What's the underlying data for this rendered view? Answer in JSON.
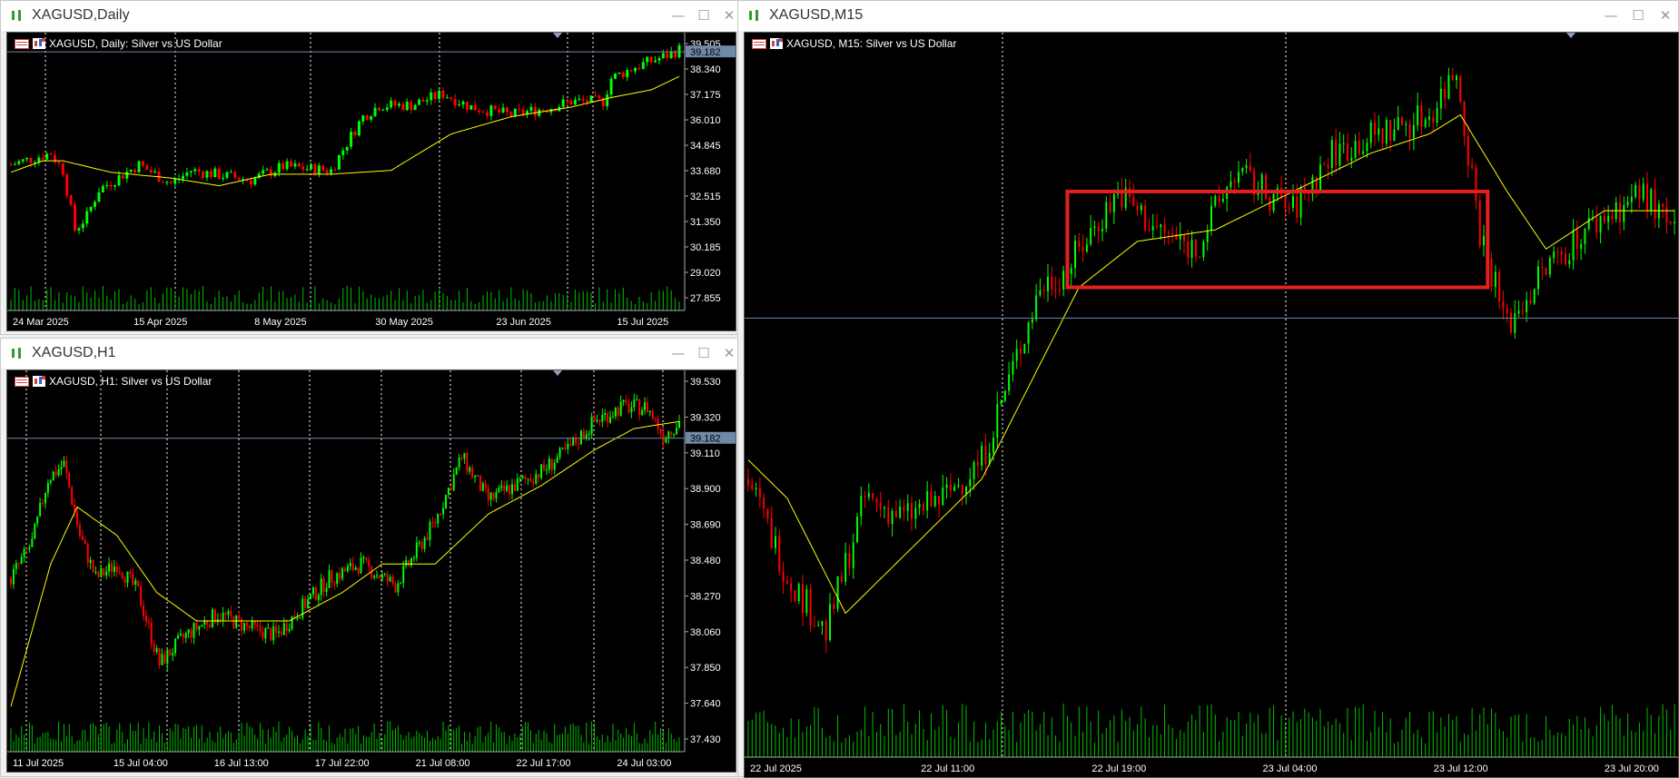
{
  "colors": {
    "bull": "#00ff00",
    "bear": "#ff0000",
    "ma": "#ffff00",
    "volume": "#00c000",
    "price_line": "#6f8aa8",
    "grid": "#ffffff",
    "axis_text": "#ffffff",
    "box": "#e32020"
  },
  "windows": [
    {
      "id": "daily",
      "title": "XAGUSD,Daily",
      "symbol_label": "XAGUSD, Daily:  Silver vs US Dollar",
      "current_price": "39.182",
      "price_axis": [
        "39.505",
        "38.340",
        "37.175",
        "36.010",
        "34.845",
        "33.680",
        "32.515",
        "31.350",
        "30.185",
        "29.020",
        "27.855"
      ],
      "time_axis": [
        "24 Mar 2025",
        "15 Apr 2025",
        "8 May 2025",
        "30 May 2025",
        "23 Jun 2025",
        "15 Jul 2025"
      ],
      "chart_data": {
        "type": "candlestick",
        "ylim": [
          27.3,
          39.9
        ],
        "anchors": [
          [
            0,
            33.3
          ],
          [
            10,
            33.9
          ],
          [
            13,
            33.0
          ],
          [
            16,
            29.9
          ],
          [
            19,
            30.6
          ],
          [
            22,
            32.0
          ],
          [
            32,
            33.3
          ],
          [
            40,
            32.3
          ],
          [
            45,
            33.0
          ],
          [
            60,
            32.5
          ],
          [
            68,
            33.2
          ],
          [
            80,
            33.0
          ],
          [
            85,
            34.8
          ],
          [
            88,
            35.8
          ],
          [
            92,
            36.4
          ],
          [
            100,
            36.4
          ],
          [
            108,
            37.0
          ],
          [
            115,
            36.3
          ],
          [
            125,
            35.9
          ],
          [
            135,
            36.3
          ],
          [
            140,
            36.6
          ],
          [
            148,
            36.6
          ],
          [
            150,
            37.8
          ],
          [
            156,
            38.4
          ],
          [
            164,
            39.0
          ],
          [
            167,
            39.3
          ]
        ],
        "n": 168,
        "ma_anchors": [
          [
            0,
            32.9
          ],
          [
            8,
            33.5
          ],
          [
            13,
            33.5
          ],
          [
            25,
            32.9
          ],
          [
            40,
            32.6
          ],
          [
            52,
            32.2
          ],
          [
            65,
            32.8
          ],
          [
            80,
            32.8
          ],
          [
            95,
            33.0
          ],
          [
            110,
            34.9
          ],
          [
            125,
            35.8
          ],
          [
            140,
            36.3
          ],
          [
            150,
            36.8
          ],
          [
            160,
            37.2
          ],
          [
            167,
            37.9
          ]
        ]
      }
    },
    {
      "id": "h1",
      "title": "XAGUSD,H1",
      "symbol_label": "XAGUSD, H1:  Silver vs US Dollar",
      "current_price": "39.182",
      "price_axis": [
        "39.530",
        "39.320",
        "39.110",
        "38.900",
        "38.690",
        "38.480",
        "38.270",
        "38.060",
        "37.850",
        "37.640",
        "37.430"
      ],
      "time_axis": [
        "11 Jul 2025",
        "15 Jul 04:00",
        "16 Jul 13:00",
        "17 Jul 22:00",
        "21 Jul 08:00",
        "22 Jul 17:00",
        "24 Jul 03:00"
      ],
      "chart_data": {
        "type": "candlestick",
        "ylim": [
          37.25,
          39.62
        ],
        "anchors": [
          [
            0,
            38.2
          ],
          [
            8,
            38.45
          ],
          [
            14,
            38.9
          ],
          [
            20,
            39.0
          ],
          [
            26,
            38.5
          ],
          [
            32,
            38.2
          ],
          [
            40,
            38.3
          ],
          [
            48,
            38.1
          ],
          [
            56,
            37.6
          ],
          [
            66,
            37.8
          ],
          [
            78,
            37.95
          ],
          [
            90,
            37.85
          ],
          [
            100,
            37.8
          ],
          [
            110,
            38.0
          ],
          [
            120,
            38.2
          ],
          [
            132,
            38.3
          ],
          [
            145,
            38.15
          ],
          [
            160,
            38.6
          ],
          [
            170,
            39.05
          ],
          [
            180,
            38.75
          ],
          [
            190,
            38.85
          ],
          [
            200,
            38.95
          ],
          [
            210,
            39.1
          ],
          [
            220,
            39.3
          ],
          [
            230,
            39.4
          ],
          [
            240,
            39.4
          ],
          [
            246,
            39.2
          ],
          [
            252,
            39.3
          ]
        ],
        "n": 253,
        "ma_anchors": [
          [
            0,
            37.3
          ],
          [
            15,
            38.3
          ],
          [
            25,
            38.7
          ],
          [
            40,
            38.5
          ],
          [
            55,
            38.1
          ],
          [
            70,
            37.9
          ],
          [
            90,
            37.9
          ],
          [
            105,
            37.9
          ],
          [
            125,
            38.1
          ],
          [
            140,
            38.3
          ],
          [
            160,
            38.3
          ],
          [
            180,
            38.65
          ],
          [
            200,
            38.85
          ],
          [
            220,
            39.1
          ],
          [
            235,
            39.25
          ],
          [
            252,
            39.3
          ]
        ]
      }
    },
    {
      "id": "m15",
      "title": "XAGUSD,M15",
      "symbol_label": "XAGUSD, M15:  Silver vs US Dollar",
      "time_axis": [
        "22 Jul 2025",
        "22 Jul 11:00",
        "22 Jul 19:00",
        "23 Jul 04:00",
        "23 Jul 12:00",
        "23 Jul 20:00"
      ],
      "chart_data": {
        "type": "candlestick",
        "ylim": [
          38.0,
          39.7
        ],
        "anchors": [
          [
            0,
            38.55
          ],
          [
            10,
            38.3
          ],
          [
            20,
            38.15
          ],
          [
            30,
            38.5
          ],
          [
            40,
            38.45
          ],
          [
            50,
            38.5
          ],
          [
            60,
            38.6
          ],
          [
            70,
            38.9
          ],
          [
            75,
            39.05
          ],
          [
            82,
            39.1
          ],
          [
            95,
            39.3
          ],
          [
            105,
            39.2
          ],
          [
            115,
            39.15
          ],
          [
            125,
            39.35
          ],
          [
            140,
            39.25
          ],
          [
            150,
            39.4
          ],
          [
            162,
            39.45
          ],
          [
            175,
            39.5
          ],
          [
            182,
            39.62
          ],
          [
            188,
            39.2
          ],
          [
            195,
            38.95
          ],
          [
            205,
            39.1
          ],
          [
            215,
            39.2
          ],
          [
            230,
            39.3
          ],
          [
            238,
            39.18
          ]
        ],
        "n": 239,
        "ma_anchors": [
          [
            0,
            38.6
          ],
          [
            10,
            38.5
          ],
          [
            25,
            38.2
          ],
          [
            40,
            38.35
          ],
          [
            60,
            38.55
          ],
          [
            70,
            38.75
          ],
          [
            85,
            39.05
          ],
          [
            100,
            39.17
          ],
          [
            120,
            39.2
          ],
          [
            140,
            39.3
          ],
          [
            160,
            39.4
          ],
          [
            175,
            39.45
          ],
          [
            183,
            39.5
          ],
          [
            195,
            39.3
          ],
          [
            205,
            39.15
          ],
          [
            220,
            39.25
          ],
          [
            238,
            39.25
          ]
        ],
        "marked_range": {
          "price_high": "39.30",
          "price_low": "39.05"
        }
      }
    }
  ]
}
